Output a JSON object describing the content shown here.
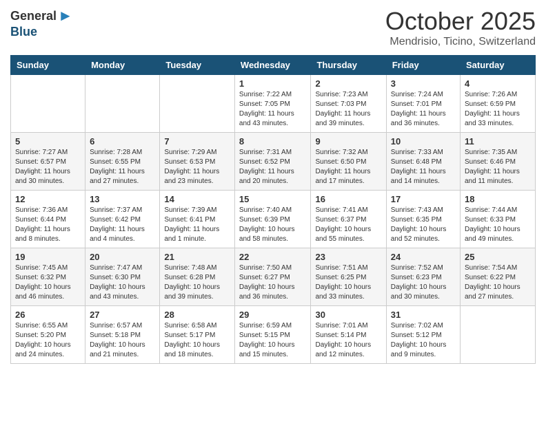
{
  "header": {
    "logo_general": "General",
    "logo_blue": "Blue",
    "month_title": "October 2025",
    "location": "Mendrisio, Ticino, Switzerland"
  },
  "days_of_week": [
    "Sunday",
    "Monday",
    "Tuesday",
    "Wednesday",
    "Thursday",
    "Friday",
    "Saturday"
  ],
  "weeks": [
    [
      {
        "day": "",
        "info": ""
      },
      {
        "day": "",
        "info": ""
      },
      {
        "day": "",
        "info": ""
      },
      {
        "day": "1",
        "info": "Sunrise: 7:22 AM\nSunset: 7:05 PM\nDaylight: 11 hours and 43 minutes."
      },
      {
        "day": "2",
        "info": "Sunrise: 7:23 AM\nSunset: 7:03 PM\nDaylight: 11 hours and 39 minutes."
      },
      {
        "day": "3",
        "info": "Sunrise: 7:24 AM\nSunset: 7:01 PM\nDaylight: 11 hours and 36 minutes."
      },
      {
        "day": "4",
        "info": "Sunrise: 7:26 AM\nSunset: 6:59 PM\nDaylight: 11 hours and 33 minutes."
      }
    ],
    [
      {
        "day": "5",
        "info": "Sunrise: 7:27 AM\nSunset: 6:57 PM\nDaylight: 11 hours and 30 minutes."
      },
      {
        "day": "6",
        "info": "Sunrise: 7:28 AM\nSunset: 6:55 PM\nDaylight: 11 hours and 27 minutes."
      },
      {
        "day": "7",
        "info": "Sunrise: 7:29 AM\nSunset: 6:53 PM\nDaylight: 11 hours and 23 minutes."
      },
      {
        "day": "8",
        "info": "Sunrise: 7:31 AM\nSunset: 6:52 PM\nDaylight: 11 hours and 20 minutes."
      },
      {
        "day": "9",
        "info": "Sunrise: 7:32 AM\nSunset: 6:50 PM\nDaylight: 11 hours and 17 minutes."
      },
      {
        "day": "10",
        "info": "Sunrise: 7:33 AM\nSunset: 6:48 PM\nDaylight: 11 hours and 14 minutes."
      },
      {
        "day": "11",
        "info": "Sunrise: 7:35 AM\nSunset: 6:46 PM\nDaylight: 11 hours and 11 minutes."
      }
    ],
    [
      {
        "day": "12",
        "info": "Sunrise: 7:36 AM\nSunset: 6:44 PM\nDaylight: 11 hours and 8 minutes."
      },
      {
        "day": "13",
        "info": "Sunrise: 7:37 AM\nSunset: 6:42 PM\nDaylight: 11 hours and 4 minutes."
      },
      {
        "day": "14",
        "info": "Sunrise: 7:39 AM\nSunset: 6:41 PM\nDaylight: 11 hours and 1 minute."
      },
      {
        "day": "15",
        "info": "Sunrise: 7:40 AM\nSunset: 6:39 PM\nDaylight: 10 hours and 58 minutes."
      },
      {
        "day": "16",
        "info": "Sunrise: 7:41 AM\nSunset: 6:37 PM\nDaylight: 10 hours and 55 minutes."
      },
      {
        "day": "17",
        "info": "Sunrise: 7:43 AM\nSunset: 6:35 PM\nDaylight: 10 hours and 52 minutes."
      },
      {
        "day": "18",
        "info": "Sunrise: 7:44 AM\nSunset: 6:33 PM\nDaylight: 10 hours and 49 minutes."
      }
    ],
    [
      {
        "day": "19",
        "info": "Sunrise: 7:45 AM\nSunset: 6:32 PM\nDaylight: 10 hours and 46 minutes."
      },
      {
        "day": "20",
        "info": "Sunrise: 7:47 AM\nSunset: 6:30 PM\nDaylight: 10 hours and 43 minutes."
      },
      {
        "day": "21",
        "info": "Sunrise: 7:48 AM\nSunset: 6:28 PM\nDaylight: 10 hours and 39 minutes."
      },
      {
        "day": "22",
        "info": "Sunrise: 7:50 AM\nSunset: 6:27 PM\nDaylight: 10 hours and 36 minutes."
      },
      {
        "day": "23",
        "info": "Sunrise: 7:51 AM\nSunset: 6:25 PM\nDaylight: 10 hours and 33 minutes."
      },
      {
        "day": "24",
        "info": "Sunrise: 7:52 AM\nSunset: 6:23 PM\nDaylight: 10 hours and 30 minutes."
      },
      {
        "day": "25",
        "info": "Sunrise: 7:54 AM\nSunset: 6:22 PM\nDaylight: 10 hours and 27 minutes."
      }
    ],
    [
      {
        "day": "26",
        "info": "Sunrise: 6:55 AM\nSunset: 5:20 PM\nDaylight: 10 hours and 24 minutes."
      },
      {
        "day": "27",
        "info": "Sunrise: 6:57 AM\nSunset: 5:18 PM\nDaylight: 10 hours and 21 minutes."
      },
      {
        "day": "28",
        "info": "Sunrise: 6:58 AM\nSunset: 5:17 PM\nDaylight: 10 hours and 18 minutes."
      },
      {
        "day": "29",
        "info": "Sunrise: 6:59 AM\nSunset: 5:15 PM\nDaylight: 10 hours and 15 minutes."
      },
      {
        "day": "30",
        "info": "Sunrise: 7:01 AM\nSunset: 5:14 PM\nDaylight: 10 hours and 12 minutes."
      },
      {
        "day": "31",
        "info": "Sunrise: 7:02 AM\nSunset: 5:12 PM\nDaylight: 10 hours and 9 minutes."
      },
      {
        "day": "",
        "info": ""
      }
    ]
  ]
}
